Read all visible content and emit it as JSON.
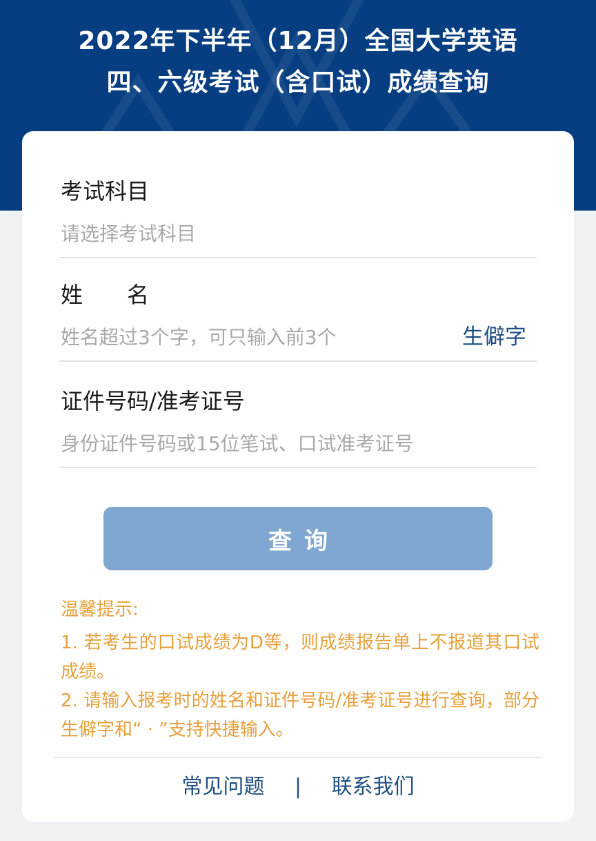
{
  "header": {
    "title_line1": "2022年下半年（12月）全国大学英语",
    "title_line2": "四、六级考试（含口试）成绩查询"
  },
  "form": {
    "subject": {
      "label": "考试科目",
      "placeholder": "请选择考试科目"
    },
    "name": {
      "label": "姓　　名",
      "placeholder": "姓名超过3个字，可只输入前3个",
      "rare_char_link": "生僻字"
    },
    "id": {
      "label": "证件号码/准考证号",
      "placeholder": "身份证件号码或15位笔试、口试准考证号"
    },
    "query_button": "查询"
  },
  "tips": {
    "title": "温馨提示:",
    "items": [
      "1. 若考生的口试成绩为D等，则成绩报告单上不报道其口试成绩。",
      "2. 请输入报考时的姓名和证件号码/准考证号进行查询，部分生僻字和“ · ”支持快捷输入。"
    ]
  },
  "footer": {
    "faq": "常见问题",
    "separator": "|",
    "contact": "联系我们"
  },
  "colors": {
    "header_bg": "#073e82",
    "button_bg": "#7fa7d1",
    "tips_text": "#e6a03c",
    "link_text": "#1f4f80"
  }
}
